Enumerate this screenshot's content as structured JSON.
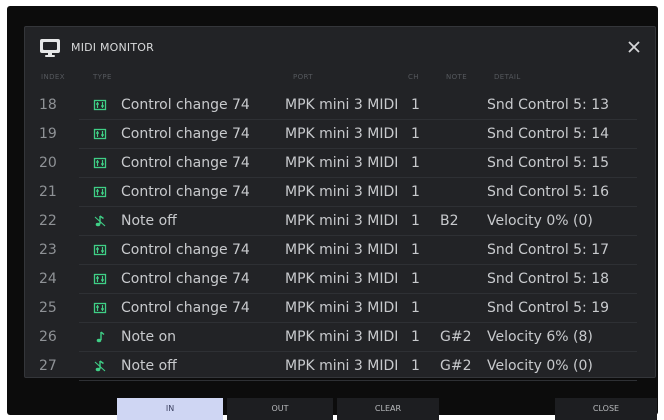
{
  "window": {
    "title": "MIDI MONITOR"
  },
  "columns": {
    "index": "INDEX",
    "type": "TYPE",
    "port": "PORT",
    "ch": "CH",
    "note": "NOTE",
    "detail": "DETAIL"
  },
  "rows": [
    {
      "index": "18",
      "icon": "control-change-icon",
      "type": "Control change 74",
      "port": "MPK mini 3 MIDI",
      "ch": "1",
      "note": "",
      "detail": "Snd Control 5: 13"
    },
    {
      "index": "19",
      "icon": "control-change-icon",
      "type": "Control change 74",
      "port": "MPK mini 3 MIDI",
      "ch": "1",
      "note": "",
      "detail": "Snd Control 5: 14"
    },
    {
      "index": "20",
      "icon": "control-change-icon",
      "type": "Control change 74",
      "port": "MPK mini 3 MIDI",
      "ch": "1",
      "note": "",
      "detail": "Snd Control 5: 15"
    },
    {
      "index": "21",
      "icon": "control-change-icon",
      "type": "Control change 74",
      "port": "MPK mini 3 MIDI",
      "ch": "1",
      "note": "",
      "detail": "Snd Control 5: 16"
    },
    {
      "index": "22",
      "icon": "note-off-icon",
      "type": "Note off",
      "port": "MPK mini 3 MIDI",
      "ch": "1",
      "note": "B2",
      "detail": "Velocity 0% (0)"
    },
    {
      "index": "23",
      "icon": "control-change-icon",
      "type": "Control change 74",
      "port": "MPK mini 3 MIDI",
      "ch": "1",
      "note": "",
      "detail": "Snd Control 5: 17"
    },
    {
      "index": "24",
      "icon": "control-change-icon",
      "type": "Control change 74",
      "port": "MPK mini 3 MIDI",
      "ch": "1",
      "note": "",
      "detail": "Snd Control 5: 18"
    },
    {
      "index": "25",
      "icon": "control-change-icon",
      "type": "Control change 74",
      "port": "MPK mini 3 MIDI",
      "ch": "1",
      "note": "",
      "detail": "Snd Control 5: 19"
    },
    {
      "index": "26",
      "icon": "note-on-icon",
      "type": "Note on",
      "port": "MPK mini 3 MIDI",
      "ch": "1",
      "note": "G#2",
      "detail": "Velocity 6% (8)"
    },
    {
      "index": "27",
      "icon": "note-off-icon",
      "type": "Note off",
      "port": "MPK mini 3 MIDI",
      "ch": "1",
      "note": "G#2",
      "detail": "Velocity 0% (0)"
    }
  ],
  "buttons": {
    "in": "IN",
    "out": "OUT",
    "clear": "CLEAR",
    "close": "CLOSE"
  },
  "colors": {
    "background": "#0c0c0c",
    "panel": "#222326",
    "accent_green": "#3fcf86",
    "active_button": "#cfd6f3"
  }
}
